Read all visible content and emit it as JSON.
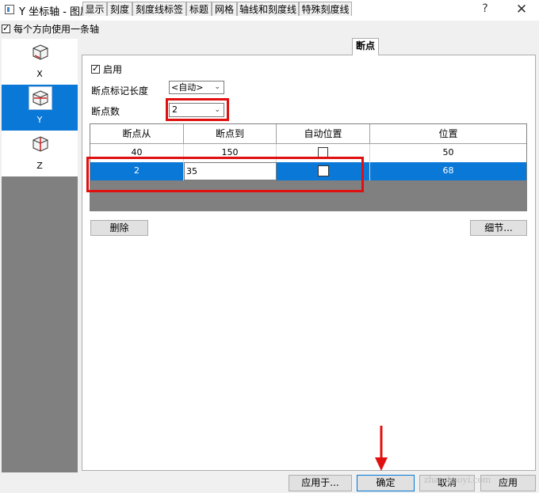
{
  "window": {
    "title": "Y 坐标轴 - 图层 1",
    "help": "?",
    "close": "✕"
  },
  "top_option": {
    "label": "每个方向使用一条轴",
    "checked": true
  },
  "axes": [
    {
      "name": "X",
      "selected": false
    },
    {
      "name": "Y",
      "selected": true
    },
    {
      "name": "Z",
      "selected": false
    }
  ],
  "tabs": [
    "显示",
    "刻度",
    "刻度线标签",
    "标题",
    "网格",
    "轴线和刻度线",
    "特殊刻度线",
    "断点"
  ],
  "active_tab": "断点",
  "breaks": {
    "enable_label": "启用",
    "enable_checked": true,
    "marker_length_label": "断点标记长度",
    "marker_length_value": "<自动>",
    "count_label": "断点数",
    "count_value": "2"
  },
  "table": {
    "columns": [
      "断点从",
      "断点到",
      "自动位置",
      "位置"
    ],
    "rows": [
      {
        "from": "40",
        "to": "150",
        "auto": false,
        "position": "50"
      },
      {
        "from": "2",
        "to": "35",
        "auto": false,
        "position": "68"
      }
    ]
  },
  "buttons": {
    "delete": "删除",
    "detail": "细节...",
    "apply_to": "应用于...",
    "ok": "确定",
    "cancel": "取消",
    "apply": "应用"
  },
  "watermark": "zhanshaoyi.com",
  "colors": {
    "selection": "#0a78d7",
    "highlight": "#e01010"
  }
}
